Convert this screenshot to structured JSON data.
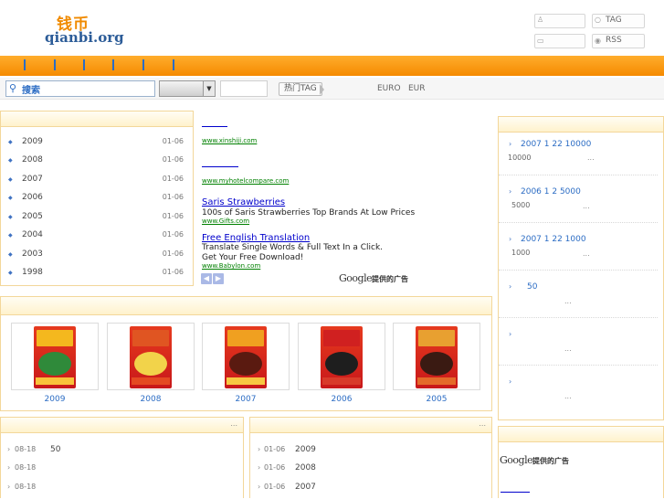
{
  "header": {
    "logo_cn": "钱币",
    "logo_en": "qianbi.org",
    "tag_label": "TAG",
    "rss_label": "RSS"
  },
  "search": {
    "button_label": "搜索",
    "hot_tag_label": "热门TAG",
    "currency_1": "EURO",
    "currency_2": "EUR"
  },
  "left_panel": {
    "years": [
      {
        "year": "2009",
        "date": "01-06"
      },
      {
        "year": "2008",
        "date": "01-06"
      },
      {
        "year": "2007",
        "date": "01-06"
      },
      {
        "year": "2006",
        "date": "01-06"
      },
      {
        "year": "2005",
        "date": "01-06"
      },
      {
        "year": "2004",
        "date": "01-06"
      },
      {
        "year": "2003",
        "date": "01-06"
      },
      {
        "year": "1998",
        "date": "01-06"
      }
    ]
  },
  "ads": {
    "items": [
      {
        "title": "",
        "text": "",
        "url": "www.xinshiji.com"
      },
      {
        "title": "",
        "text": "",
        "url": "www.myhotelcompare.com"
      },
      {
        "title": "Saris Strawberries",
        "text": "100s of Saris Strawberries Top Brands At Low Prices",
        "url": "www.Gifts.com"
      },
      {
        "title": "Free English Translation",
        "text": "Translate Single Words & Full Text In a Click. Get Your Free Download!",
        "url": "www.Babylon.com"
      }
    ],
    "prev_glyph": "◀",
    "next_glyph": "▶",
    "google_label": "Google",
    "google_sub": "提供的广告"
  },
  "right_panel": {
    "news": [
      {
        "head": "2007 1 22    10000",
        "sub": "10000",
        "dots": "..."
      },
      {
        "head": "2006 1 2    5000",
        "sub": "5000",
        "dots": "..."
      },
      {
        "head": "2007 1 22    1000",
        "sub": "1000",
        "dots": "..."
      },
      {
        "head": "50",
        "sub": "",
        "dots": "..."
      },
      {
        "head": "",
        "sub": "",
        "dots": "..."
      },
      {
        "head": "",
        "sub": "",
        "dots": "..."
      }
    ],
    "google_label": "Google",
    "google_sub": "提供的广告"
  },
  "gallery": {
    "items": [
      {
        "label": "2009"
      },
      {
        "label": "2008"
      },
      {
        "label": "2007"
      },
      {
        "label": "2006"
      },
      {
        "label": "2005"
      }
    ]
  },
  "bottom_left": {
    "more": "...",
    "rows": [
      {
        "date": "08-18",
        "text": "50"
      },
      {
        "date": "08-18",
        "text": ""
      },
      {
        "date": "08-18",
        "text": ""
      }
    ]
  },
  "bottom_mid": {
    "more": "...",
    "rows": [
      {
        "date": "01-06",
        "text": "2009"
      },
      {
        "date": "01-06",
        "text": "2008"
      },
      {
        "date": "01-06",
        "text": "2007"
      }
    ]
  },
  "colors": {
    "nav_orange": "#f58a00",
    "link_blue": "#2b6cc4",
    "panel_border": "#f3d79a",
    "envelope_red": "#c8181a"
  }
}
